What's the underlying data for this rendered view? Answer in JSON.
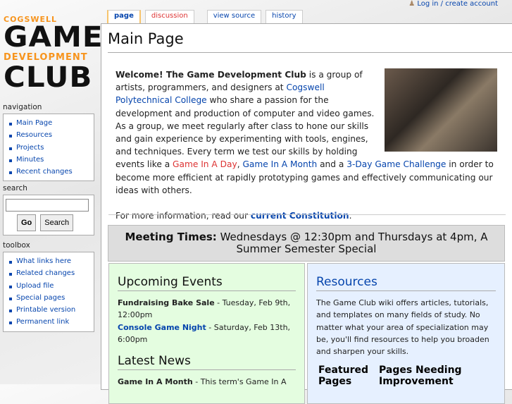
{
  "logo": {
    "top": "COGSWELL",
    "line1": "GAME",
    "line2": "DEVELOPMENT",
    "line3": "CLUB"
  },
  "user_link": "Log in / create account",
  "tabs": [
    "page",
    "discussion",
    "view source",
    "history"
  ],
  "navigation": {
    "label": "navigation",
    "items": [
      "Main Page",
      "Resources",
      "Projects",
      "Minutes",
      "Recent changes"
    ]
  },
  "search": {
    "label": "search",
    "go": "Go",
    "search": "Search",
    "value": ""
  },
  "toolbox": {
    "label": "toolbox",
    "items": [
      "What links here",
      "Related changes",
      "Upload file",
      "Special pages",
      "Printable version",
      "Permanent link"
    ]
  },
  "title": "Main Page",
  "intro": {
    "welcome": "Welcome! The Game Development Club",
    "t1": " is a group of artists, programmers, and designers at ",
    "college": "Cogswell Polytechnical College",
    "t2": " who share a passion for the development and production of computer and video games. As a group, we meet regularly after class to hone our skills and gain experience by experimenting with tools, engines, and techniques. Every term we test our skills by holding events like a ",
    "day": "Game In A Day",
    "t3": ", ",
    "month": "Game In A Month",
    "t4": " and a ",
    "challenge": "3-Day Game Challenge",
    "t5": " in order to become more efficient at rapidly prototyping games and effectively communicating our ideas with others.",
    "more": "For more information, read our ",
    "constitution": "current Constitution",
    "dot": "."
  },
  "meeting": {
    "label": "Meeting Times:",
    "text": " Wednesdays @ 12:30pm and Thursdays at 4pm, A Summer Semester Special"
  },
  "events": {
    "title": "Upcoming Events",
    "e1": "Fundraising Bake Sale",
    "e1d": " - Tuesday, Feb 9th, 12:00pm",
    "e2": "Console Game Night",
    "e2d": " - Saturday, Feb 13th, 6:00pm"
  },
  "news": {
    "title": "Latest News",
    "n1": "Game In A Month",
    "n1d": " - This term's Game In A"
  },
  "resources": {
    "title": "Resources",
    "text": "The Game Club wiki offers articles, tutorials, and templates on many fields of study. No matter what your area of specialization may be, you'll find resources to help you broaden and sharpen your skills.",
    "col1": "Featured Pages",
    "col2": "Pages Needing Improvement"
  }
}
